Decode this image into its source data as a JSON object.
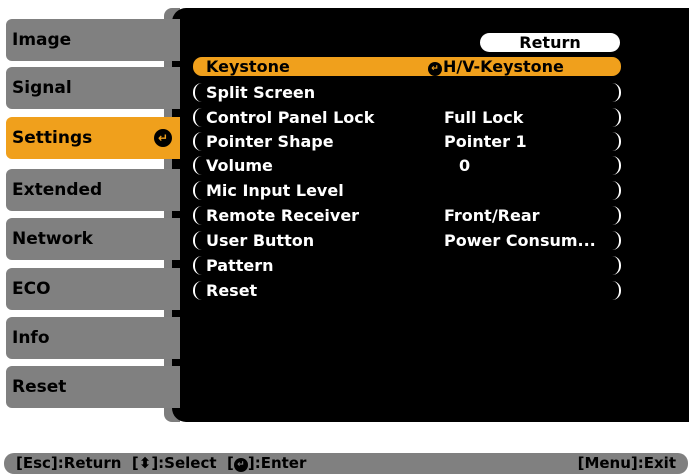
{
  "tabs": [
    {
      "label": "Image"
    },
    {
      "label": "Signal"
    },
    {
      "label": "Settings",
      "active": true
    },
    {
      "label": "Extended"
    },
    {
      "label": "Network"
    },
    {
      "label": "ECO"
    },
    {
      "label": "Info"
    },
    {
      "label": "Reset"
    }
  ],
  "submenu": {
    "return_label": "Return",
    "rows": [
      {
        "label": "Keystone",
        "value": "H/V-Keystone"
      },
      {
        "label": "Split Screen",
        "value": ""
      },
      {
        "label": "Control Panel Lock",
        "value": "Full Lock"
      },
      {
        "label": "Pointer Shape",
        "value": "Pointer 1"
      },
      {
        "label": "Volume",
        "value": "0"
      },
      {
        "label": "Mic Input Level",
        "value": ""
      },
      {
        "label": "Remote Receiver",
        "value": "Front/Rear"
      },
      {
        "label": "User Button",
        "value": "Power Consum..."
      },
      {
        "label": "Pattern",
        "value": ""
      },
      {
        "label": "Reset",
        "value": ""
      }
    ]
  },
  "helpbar": {
    "esc": "[Esc]:Return",
    "select_pre": "[",
    "select_post": "]:Select",
    "enter_pre": "[",
    "enter_post": "]:Enter",
    "menu": "[Menu]:Exit"
  },
  "colors": {
    "accent": "#f0a01c",
    "tab_bg": "#808080",
    "panel_bg": "#000000"
  },
  "icons": {
    "enter": "enter-icon",
    "updown": "up-down-arrows-icon"
  }
}
